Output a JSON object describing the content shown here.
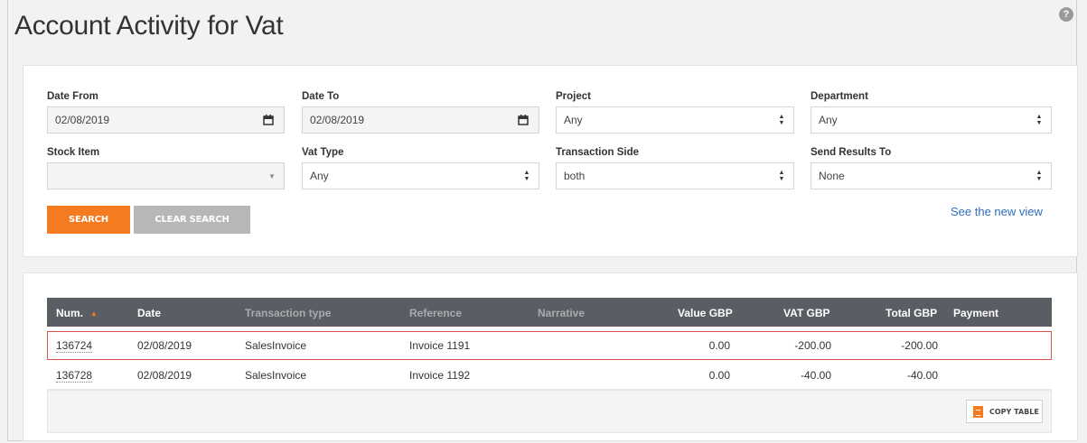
{
  "header": {
    "title": "Account Activity for Vat",
    "help_icon": "question-circle-icon"
  },
  "search": {
    "date_from": {
      "label": "Date From",
      "value": "02/08/2019",
      "icon": "calendar-icon"
    },
    "date_to": {
      "label": "Date To",
      "value": "02/08/2019",
      "icon": "calendar-icon"
    },
    "project": {
      "label": "Project",
      "value": "Any"
    },
    "department": {
      "label": "Department",
      "value": "Any"
    },
    "stock_item": {
      "label": "Stock Item",
      "value": ""
    },
    "vat_type": {
      "label": "Vat Type",
      "value": "Any"
    },
    "transaction_side": {
      "label": "Transaction Side",
      "value": "both"
    },
    "send_results_to": {
      "label": "Send Results To",
      "value": "None"
    },
    "search_button": "SEARCH",
    "clear_button": "CLEAR SEARCH",
    "new_view_link": "See the new view"
  },
  "table": {
    "columns": [
      "Num.",
      "Date",
      "Transaction type",
      "Reference",
      "Narrative",
      "Value GBP",
      "VAT GBP",
      "Total GBP",
      "Payment"
    ],
    "sort_column": "Num.",
    "rows": [
      {
        "num": "136724",
        "date": "02/08/2019",
        "type": "SalesInvoice",
        "reference": "Invoice 1191",
        "narrative": "",
        "value": "0.00",
        "vat": "-200.00",
        "total": "-200.00",
        "payment": ""
      },
      {
        "num": "136728",
        "date": "02/08/2019",
        "type": "SalesInvoice",
        "reference": "Invoice 1192",
        "narrative": "",
        "value": "0.00",
        "vat": "-40.00",
        "total": "-40.00",
        "payment": ""
      }
    ],
    "copy_button": "COPY TABLE"
  },
  "colors": {
    "accent": "#f47b20",
    "header_bg": "#5a5d63",
    "link": "#2f6dbf",
    "highlight": "#d9534f"
  }
}
